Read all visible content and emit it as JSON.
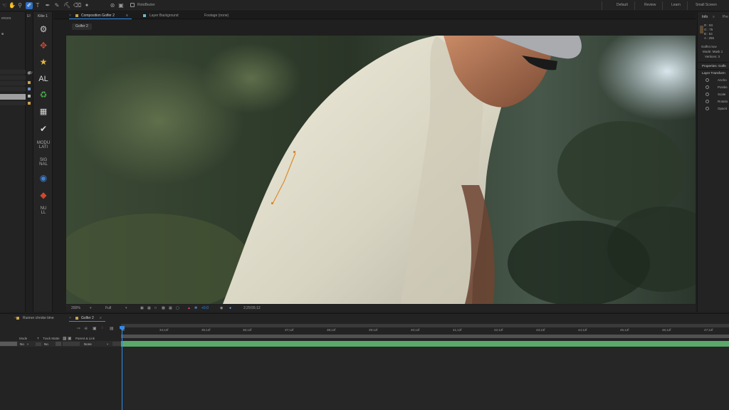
{
  "toolbar": {
    "rotobezier_label": "RotoBezier",
    "workspaces": [
      "Default",
      "Review",
      "Learn",
      "Small Screen"
    ]
  },
  "project_panel": {
    "label": "ences",
    "type_column": "Type"
  },
  "fx_panel": {
    "tab_label": "Ef"
  },
  "klite_panel": {
    "tab_label": "Klite 1",
    "buttons": {
      "align": "AL",
      "modulation": [
        "MODU",
        "LATI"
      ],
      "signal": [
        "SIG",
        "NAL"
      ],
      "null": [
        "NU",
        "LL"
      ]
    }
  },
  "comp_panel": {
    "tabs": {
      "composition": "Composition Golfer 2",
      "layer": "Layer Background",
      "footage": "Footage (none)"
    },
    "subtab": "Golfer 2",
    "controls": {
      "zoom": "200%",
      "resolution": "Full",
      "exposure": "+0.0",
      "timecode": "2;29;55;12"
    }
  },
  "info_panel": {
    "tab_info": "Info",
    "tab_preview": "Pre",
    "color": {
      "r": "R : 93",
      "g": "G : 75",
      "b": "B : 54",
      "a": "A : 255"
    },
    "file": "Golfer.mov",
    "mode": "Mode: Mask 1",
    "vertices": "Vertices: 3",
    "properties_label": "Properties: Golfe",
    "layer_transform": "Layer Transform",
    "transform_props": [
      "Ancho",
      "Positio",
      "Scale",
      "Rotatio",
      "Opacit"
    ]
  },
  "timeline": {
    "tabs": {
      "render": "Render Queue",
      "comp": "Golfer 2"
    },
    "render_queue_hint": "Runner chroke time",
    "columns": {
      "mode": "Mode",
      "t": "T",
      "track_matte": "Track Matte",
      "parent": "Parent & Link"
    },
    "mode_value": "No",
    "matte_value": "No",
    "parent_value": "None",
    "ruler": [
      "0f",
      "34;12f",
      "35;12f",
      "36;12f",
      "37;12f",
      "38;12f",
      "39;12f",
      "40;12f",
      "41;12f",
      "42;12f",
      "43;12f",
      "44;12f",
      "45;12f",
      "46;12f",
      "47;12f"
    ]
  },
  "colors": {
    "accent": "#2d8ceb",
    "layer_bar": "#5aa86a",
    "mask_path": "#d98c2b"
  }
}
